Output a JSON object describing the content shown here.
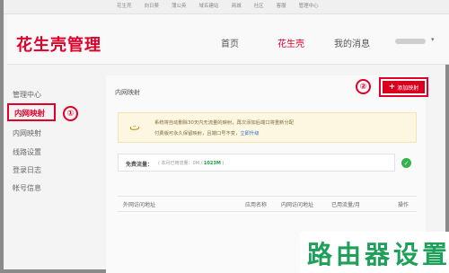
{
  "top_strip": {
    "links": [
      "花生壳",
      "向日葵",
      "蒲公英",
      "域名建站",
      "商城",
      "社区",
      "客服",
      "管理中心"
    ]
  },
  "header": {
    "logo": "花生壳管理",
    "nav": [
      "首页",
      "花生壳",
      "我的消息"
    ],
    "active_nav": "花生壳",
    "user_caret": "▾"
  },
  "sidebar": {
    "items": [
      "管理中心",
      "内网映射",
      "内网映射",
      "线路设置",
      "登录日志",
      "帐号信息"
    ],
    "active_index": 1,
    "marker": "①"
  },
  "content": {
    "title": "内网映射",
    "marker": "②",
    "add_button": {
      "plus": "+",
      "label": "添加映射"
    },
    "notice": {
      "icon": "smile-icon",
      "line1": "系统将自动删除30天内无流量的映射，再次添加后端口将重新分配",
      "line2_prefix": "付费版可永久保留映射，且端口号不变，",
      "link": "立即升级"
    },
    "quota": {
      "label": "免费流量：",
      "detail_prefix": "( 本月已用流量：0M / ",
      "detail_value": "1023M",
      "detail_suffix": " )",
      "ok_icon": "check-circle-icon"
    },
    "table_headers": [
      "外网访问地址",
      "应用名称",
      "内网访问地址",
      "已用流量/月",
      "操作"
    ]
  },
  "watermark": "路由器设置",
  "colors": {
    "brand_red": "#e0002a",
    "notice_bg": "#fdf7e1",
    "ok_green": "#35b24a",
    "watermark_green": "#1fa05a"
  }
}
